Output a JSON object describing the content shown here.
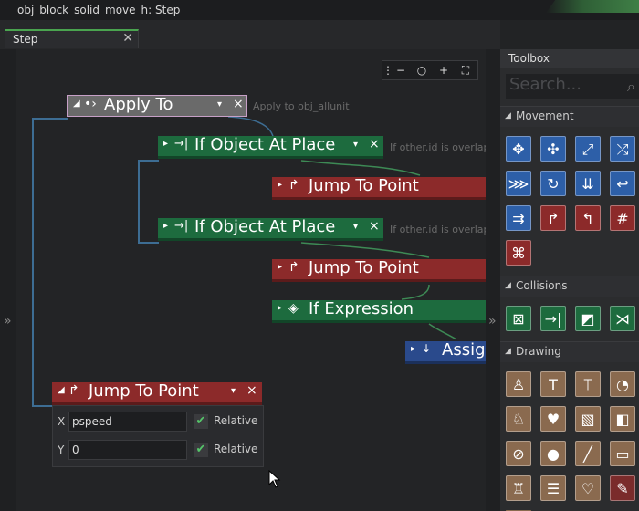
{
  "window": {
    "title": "obj_block_solid_move_h: Step"
  },
  "tab": {
    "label": "Step",
    "close": "✕"
  },
  "zoom": {
    "menu": "⋮",
    "zoom_out": "−",
    "zoom_reset": "○",
    "zoom_in": "+",
    "fit": "⛶"
  },
  "nodes": {
    "apply_to": {
      "label": "Apply To",
      "icon": "•›",
      "note": "Apply to obj_allunit"
    },
    "if_object_1": {
      "label": "If Object At Place",
      "icon": "→|",
      "note": "If other.id is overlap"
    },
    "jump_1": {
      "label": "Jump To Point",
      "icon": "↱"
    },
    "if_object_2": {
      "label": "If Object At Place",
      "icon": "→|",
      "note": "If other.id is overlap"
    },
    "jump_2": {
      "label": "Jump To Point",
      "icon": "↱"
    },
    "if_expression": {
      "label": "If Expression",
      "icon": "◈"
    },
    "assign": {
      "label": "Assig",
      "icon": "↓"
    },
    "jump_panel": {
      "label": "Jump To Point",
      "icon": "↱",
      "x_label": "X",
      "x_value": "pspeed",
      "y_label": "Y",
      "y_value": "0",
      "relative_label": "Relative"
    }
  },
  "toolbox": {
    "title": "Toolbox",
    "search_placeholder": "Search...",
    "sections": {
      "movement": "Movement",
      "collisions": "Collisions",
      "drawing": "Drawing"
    }
  },
  "icons": {
    "tri_down": "◢",
    "tri_right": "▸",
    "dropdown": "▾",
    "close": "×",
    "check": "✔",
    "gutter_left": "»",
    "gutter_right": "»",
    "search": "⌕"
  },
  "colors": {
    "green_accent": "#4aa44f",
    "node_green": "#1d6b3e",
    "node_red": "#8c2a2a",
    "node_gray": "#6a6a6a",
    "node_blue": "#2a4a8c",
    "tool_blue": "#2d5fa8",
    "tool_brown": "#8a6a4f"
  }
}
